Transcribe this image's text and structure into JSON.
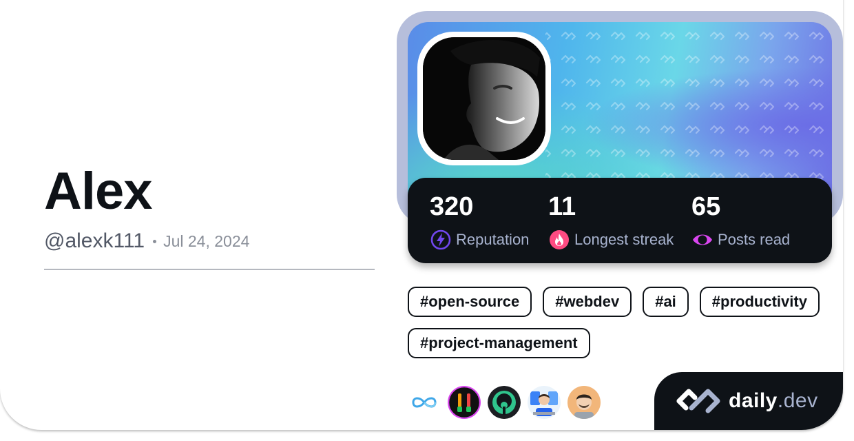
{
  "profile": {
    "name": "Alex",
    "handle": "@alexk111",
    "joined": "Jul 24, 2024"
  },
  "stats": [
    {
      "value": "320",
      "label": "Reputation",
      "icon": "lightning-icon",
      "color": "#7147ed"
    },
    {
      "value": "11",
      "label": "Longest streak",
      "icon": "flame-icon",
      "color": "#ff4b82"
    },
    {
      "value": "65",
      "label": "Posts read",
      "icon": "eye-icon",
      "color": "#d946ef"
    }
  ],
  "tags": [
    "#open-source",
    "#webdev",
    "#ai",
    "#productivity",
    "#project-management"
  ],
  "squads": [
    "squad-links-icon",
    "squad-tools-icon",
    "squad-orb-icon",
    "squad-developer-icon",
    "squad-person-icon"
  ],
  "brand": {
    "part1": "daily",
    "part2": ".dev"
  },
  "colors": {
    "dark": "#0e1217",
    "accent_frame": "#b6bedb",
    "muted_text": "#a8b3cf"
  }
}
